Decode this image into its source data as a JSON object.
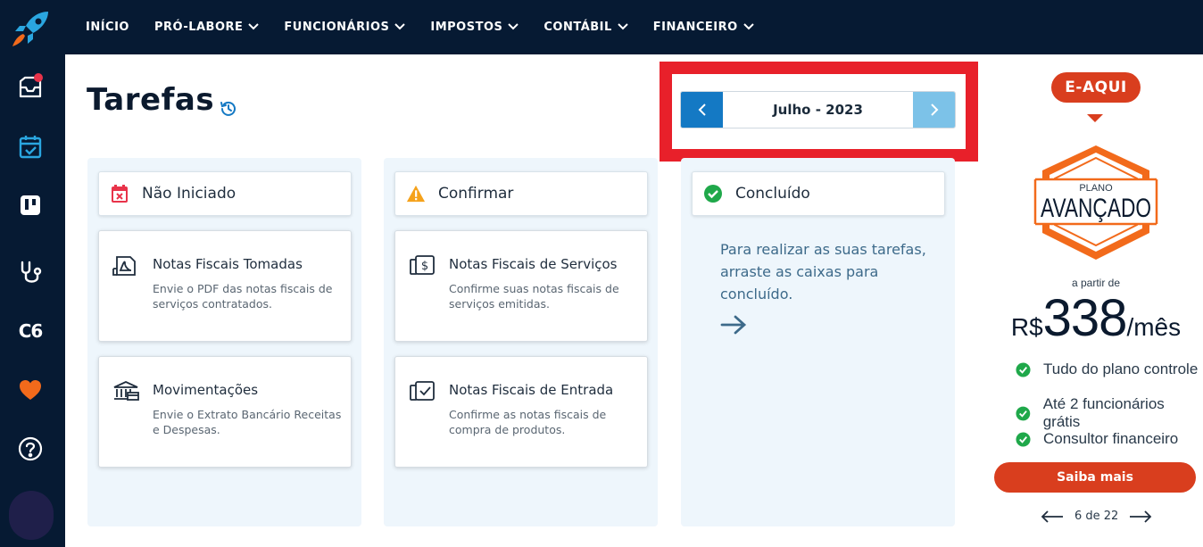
{
  "nav": {
    "items": [
      {
        "label": "INÍCIO",
        "dropdown": false
      },
      {
        "label": "PRÓ-LABORE",
        "dropdown": true
      },
      {
        "label": "FUNCIONÁRIOS",
        "dropdown": true
      },
      {
        "label": "IMPOSTOS",
        "dropdown": true
      },
      {
        "label": "CONTÁBIL",
        "dropdown": true
      },
      {
        "label": "FINANCEIRO",
        "dropdown": true
      }
    ]
  },
  "sidebar": {
    "items": [
      {
        "icon": "inbox-icon",
        "has_badge": true
      },
      {
        "icon": "calendar-check-icon",
        "has_badge": false
      },
      {
        "icon": "kanban-icon",
        "has_badge": false
      },
      {
        "icon": "stethoscope-icon",
        "has_badge": false
      },
      {
        "icon": "c6-bank-icon",
        "label": "C6"
      },
      {
        "icon": "heart-icon",
        "has_badge": false
      },
      {
        "icon": "help-icon",
        "has_badge": false
      }
    ]
  },
  "page": {
    "title": "Tarefas"
  },
  "month_picker": {
    "label": "Julho - 2023"
  },
  "columns": [
    {
      "header": "Não Iniciado",
      "icon": "calendar-x-icon",
      "cards": [
        {
          "icon": "pdf-document-icon",
          "title": "Notas Fiscais Tomadas",
          "desc": "Envie o PDF das notas fiscais de serviços contratados."
        },
        {
          "icon": "bank-icon",
          "title": "Movimentações",
          "desc": "Envie o Extrato Bancário Receitas e Despesas."
        }
      ]
    },
    {
      "header": "Confirmar",
      "icon": "warning-icon",
      "cards": [
        {
          "icon": "invoice-dollar-icon",
          "title": "Notas Fiscais de Serviços",
          "desc": "Confirme suas notas fiscais de serviços emitidas."
        },
        {
          "icon": "invoice-check-icon",
          "title": "Notas Fiscais de Entrada",
          "desc": "Confirme as notas fiscais de compra de produtos."
        }
      ]
    },
    {
      "header": "Concluído",
      "icon": "check-circle-icon",
      "text": "Para realizar as suas tarefas, arraste as caixas para concluído."
    }
  ],
  "promo": {
    "tag": "E-AQUI",
    "plan_small": "PLANO",
    "plan_name": "AVANÇADO",
    "from_label": "a partir de",
    "currency": "R$",
    "price": "338",
    "period": "/mês",
    "features": [
      "Tudo do plano controle",
      "Até 2 funcionários grátis",
      "Consultor financeiro"
    ],
    "cta": "Saiba mais",
    "pager": "6 de 22"
  },
  "colors": {
    "navy": "#061a33",
    "primary_blue": "#1479c4",
    "light_blue": "#7cc2e8",
    "orange": "#d93e1e",
    "highlight_red": "#e8202a",
    "column_bg": "#eef6fc"
  }
}
